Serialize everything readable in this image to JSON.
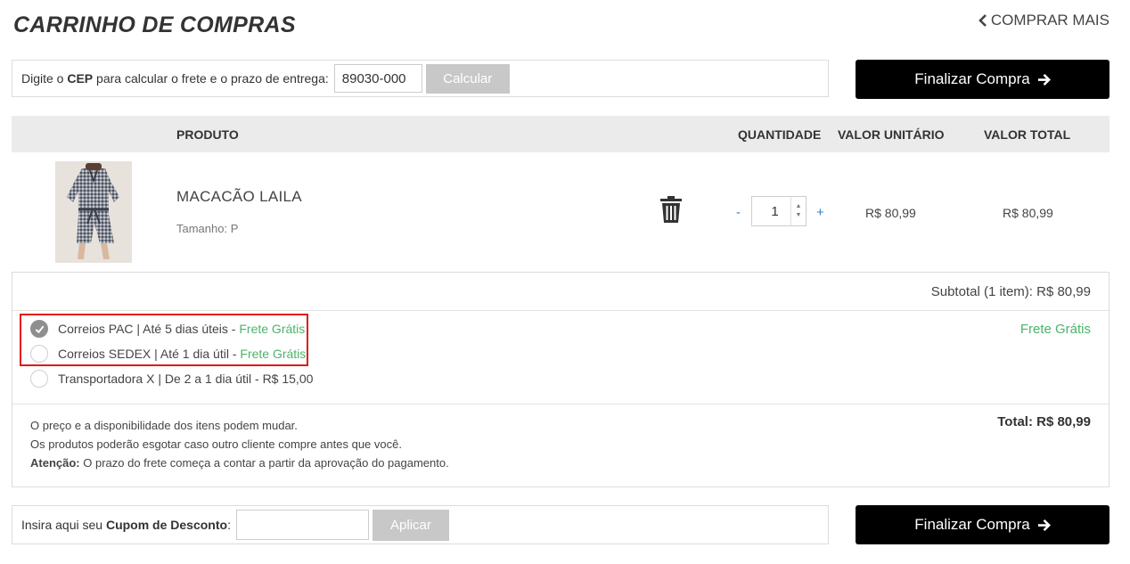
{
  "page": {
    "title": "CARRINHO DE COMPRAS",
    "back_link": "COMPRAR MAIS"
  },
  "cep": {
    "label_prefix": "Digite o ",
    "label_bold": "CEP",
    "label_suffix": " para calcular o frete e o prazo de entrega:",
    "value": "89030-000",
    "button": "Calcular"
  },
  "checkout_button": "Finalizar Compra",
  "table": {
    "headers": {
      "product": "PRODUTO",
      "quantity": "QUANTIDADE",
      "unit": "VALOR UNITÁRIO",
      "total": "VALOR TOTAL"
    }
  },
  "item": {
    "name": "MACACÃO LAILA",
    "size": "Tamanho: P",
    "qty_minus": "-",
    "quantity": "1",
    "qty_plus": "+",
    "unit_price": "R$ 80,99",
    "total_price": "R$ 80,99"
  },
  "summary": {
    "subtotal": "Subtotal (1 item): R$ 80,99",
    "frete_value": "Frete Grátis",
    "total": "Total: R$ 80,99"
  },
  "shipping": {
    "options": [
      {
        "text": "Correios PAC | Até 5 dias úteis - ",
        "price": "Frete Grátis",
        "checked": true
      },
      {
        "text": "Correios SEDEX | Até 1 dia útil - ",
        "price": "Frete Grátis",
        "checked": false
      },
      {
        "text": "Transportadora X | De 2 a 1 dia útil - R$ 15,00",
        "price": "",
        "checked": false
      }
    ]
  },
  "notes": {
    "line1": "O preço e a disponibilidade dos itens podem mudar.",
    "line2": "Os produtos poderão esgotar caso outro cliente compre antes que você.",
    "line3_bold": "Atenção:",
    "line3_rest": " O prazo do frete começa a contar a partir da aprovação do pagamento."
  },
  "coupon": {
    "label_prefix": "Insira aqui seu ",
    "label_bold": "Cupom de Desconto",
    "label_suffix": ":",
    "value": "",
    "button": "Aplicar"
  },
  "icons": {
    "back": "chevron-left-icon",
    "arrow": "arrow-right-icon",
    "trash": "trash-icon",
    "check": "check-icon"
  },
  "colors": {
    "accent_green": "#4cb36a",
    "button_black": "#000000",
    "button_gray": "#c8c8c8",
    "highlight_red": "#e01a1a",
    "qty_blue": "#3b82c4"
  }
}
